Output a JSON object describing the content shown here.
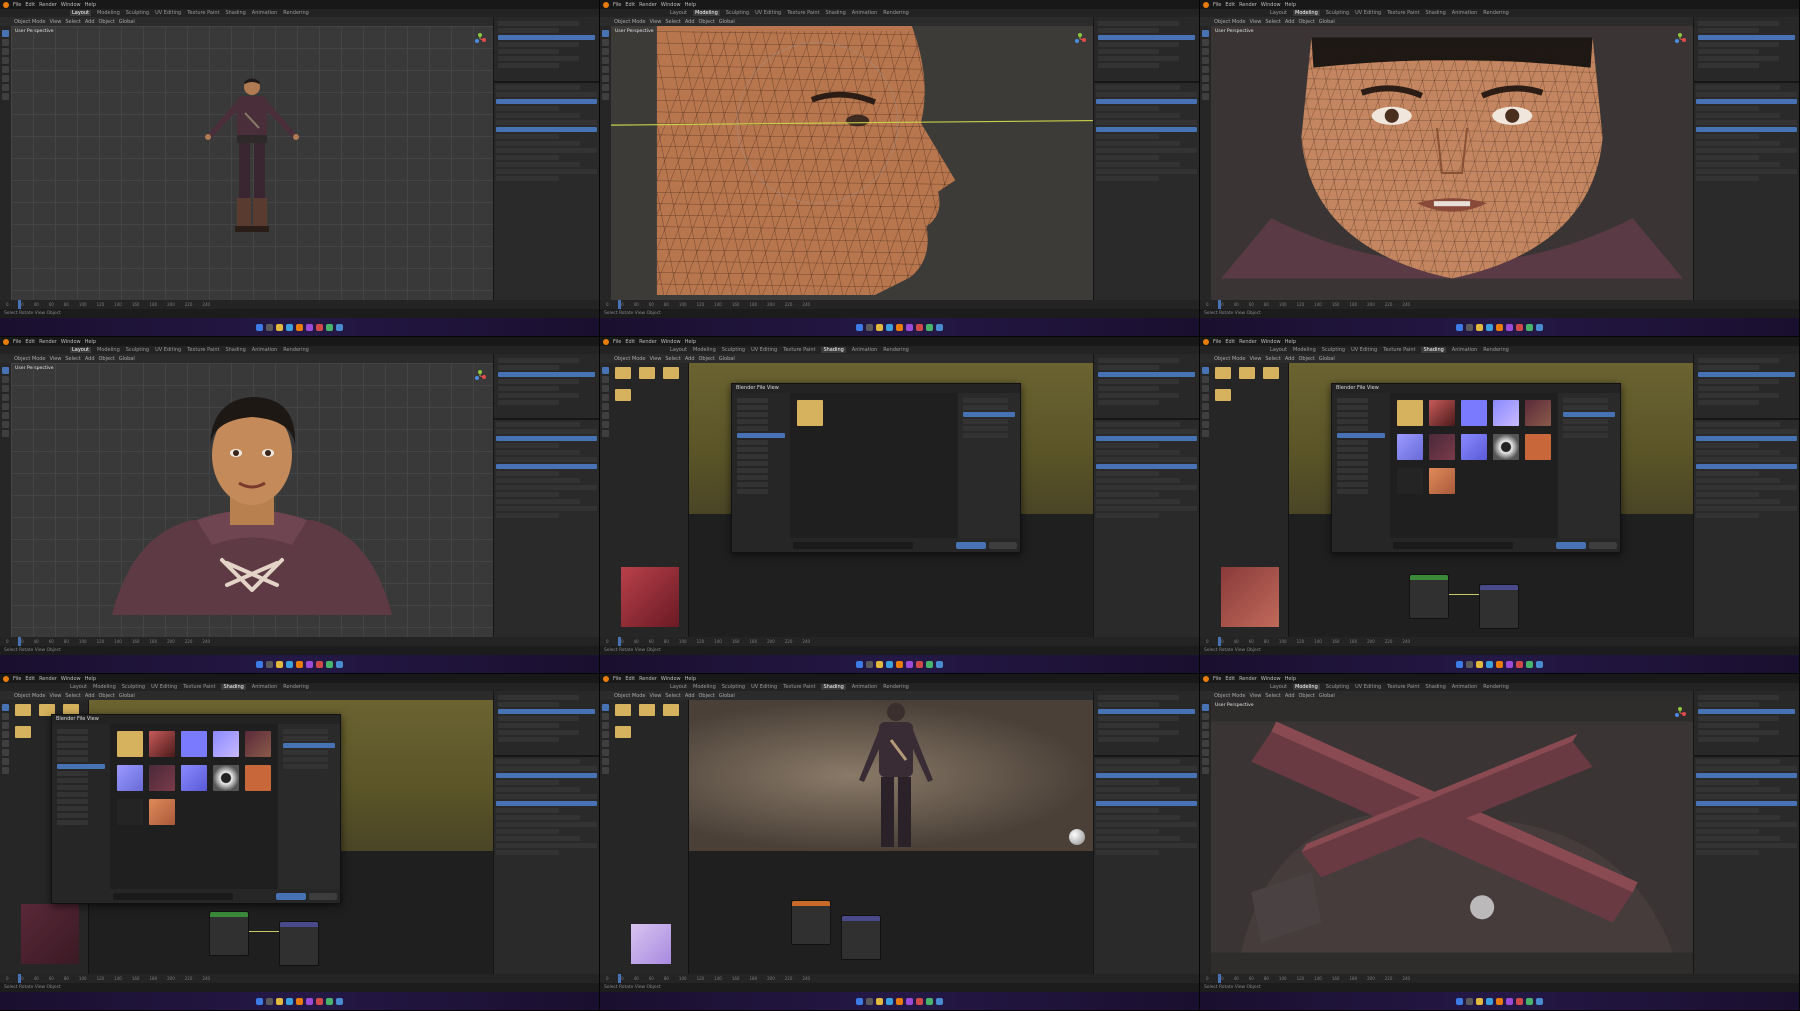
{
  "app": {
    "title": "Blender",
    "menu": [
      "File",
      "Edit",
      "Render",
      "Window",
      "Help"
    ],
    "workspaces": [
      "Layout",
      "Modeling",
      "Sculpting",
      "UV Editing",
      "Texture Paint",
      "Shading",
      "Animation",
      "Rendering"
    ],
    "header_items": [
      "Object Mode",
      "View",
      "Select",
      "Add",
      "Object",
      "Global"
    ],
    "status_text": "Select   Rotate View   Object",
    "clock": "",
    "colors": {
      "blender_orange": "#e87d0d",
      "selection_blue": "#4772b3",
      "viewport_gray": "#393939",
      "shader_olive": "#6b6330",
      "folder_yellow": "#d6b25e",
      "taskbar_purple": "#241846"
    }
  },
  "panels": [
    {
      "id": "p1",
      "scene": "full-body-character",
      "viewport_label": "User Perspective",
      "active_workspace": "Layout"
    },
    {
      "id": "p2",
      "scene": "head-profile-wireframe",
      "viewport_label": "User Perspective",
      "active_workspace": "Modeling"
    },
    {
      "id": "p3",
      "scene": "face-front-wireframe",
      "viewport_label": "User Perspective",
      "active_workspace": "Modeling"
    },
    {
      "id": "p4",
      "scene": "bust-rendered",
      "viewport_label": "User Perspective",
      "active_workspace": "Layout"
    },
    {
      "id": "p5",
      "scene": "file-browser-folder",
      "viewport_label": "",
      "active_workspace": "Shading",
      "dialog_title": "Blender File View"
    },
    {
      "id": "p6",
      "scene": "file-browser-textures",
      "viewport_label": "",
      "active_workspace": "Shading",
      "dialog_title": "Blender File View"
    },
    {
      "id": "p7",
      "scene": "file-browser-textures-large",
      "viewport_label": "",
      "active_workspace": "Shading",
      "dialog_title": "Blender File View"
    },
    {
      "id": "p8",
      "scene": "shading-back-view",
      "viewport_label": "",
      "active_workspace": "Shading"
    },
    {
      "id": "p9",
      "scene": "closeup-crossbar",
      "viewport_label": "User Perspective",
      "active_workspace": "Modeling"
    }
  ],
  "timeline_ticks": [
    "0",
    "20",
    "40",
    "60",
    "80",
    "100",
    "120",
    "140",
    "160",
    "180",
    "200",
    "220",
    "240"
  ],
  "icons": {
    "logo": "blender-logo-icon",
    "gizmo": "navigation-gizmo-icon",
    "folder": "folder-icon",
    "taskbar": [
      "windows-start-icon",
      "search-icon",
      "file-explorer-icon",
      "browser-icon",
      "blender-taskbar-icon"
    ]
  }
}
